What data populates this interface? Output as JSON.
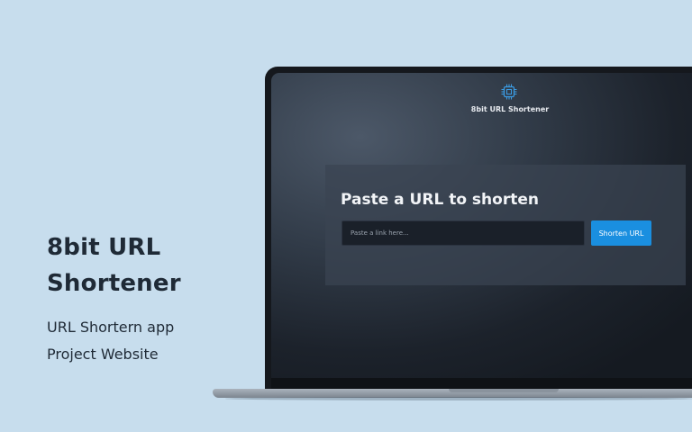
{
  "promo": {
    "title_line1": "8bit URL",
    "title_line2": "Shortener",
    "subtitle_line1": "URL Shortern app",
    "subtitle_line2": "Project Website"
  },
  "app": {
    "logo_icon": "chip-icon",
    "title": "8bit URL Shortener",
    "heading": "Paste a URL to shorten",
    "input_value": "",
    "input_placeholder": "Paste a link here...",
    "button_label": "Shorten URL"
  },
  "colors": {
    "background": "#c7dded",
    "accent": "#1a8fe0",
    "screen_dark": "#1c222b",
    "card": "#3a4452"
  }
}
